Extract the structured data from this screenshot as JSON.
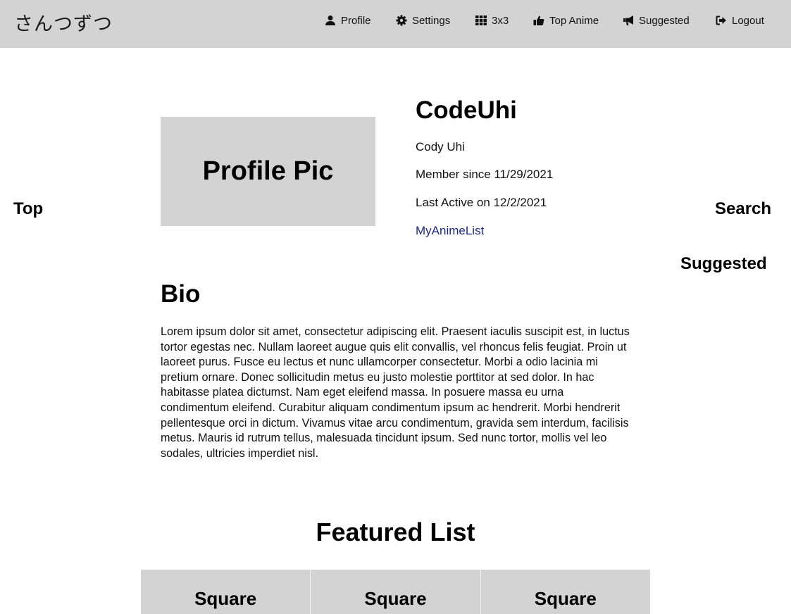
{
  "navbar": {
    "brand": "さんつずつ",
    "links": [
      {
        "label": "Profile",
        "icon": "user-icon"
      },
      {
        "label": "Settings",
        "icon": "gear-icon"
      },
      {
        "label": "3x3",
        "icon": "grid-icon"
      },
      {
        "label": "Top Anime",
        "icon": "thumbs-up-icon"
      },
      {
        "label": "Suggested",
        "icon": "megaphone-icon"
      },
      {
        "label": "Logout",
        "icon": "sign-out-icon"
      }
    ]
  },
  "sidebar": {
    "left": "Top",
    "right_search": "Search",
    "right_suggested": "Suggested"
  },
  "profile": {
    "pic_label": "Profile Pic",
    "username": "CodeUhi",
    "real_name": "Cody Uhi",
    "member_since": "Member since 11/29/2021",
    "last_active": "Last Active on 12/2/2021",
    "mal_link": "MyAnimeList"
  },
  "bio": {
    "heading": "Bio",
    "text": "Lorem ipsum dolor sit amet, consectetur adipiscing elit. Praesent iaculis suscipit est, in luctus tortor egestas nec. Nullam laoreet augue quis elit convallis, vel rhoncus felis feugiat. Proin ut laoreet purus. Fusce eu lectus et nunc ullamcorper consectetur. Morbi a odio lacinia mi pretium ornare. Donec sollicitudin metus eu justo molestie porttitor at sed dolor. In hac habitasse platea dictumst. Nam eget eleifend massa. In posuere massa eu urna condimentum eleifend. Curabitur aliquam condimentum ipsum ac hendrerit. Morbi hendrerit pellentesque orci in dictum. Vivamus vitae arcu condimentum, gravida sem interdum, facilisis metus. Mauris id rutrum tellus, malesuada tincidunt ipsum. Sed nunc tortor, mollis vel leo sodales, ultricies imperdiet nisl."
  },
  "featured": {
    "heading": "Featured List",
    "squares": [
      "Square",
      "Square",
      "Square"
    ]
  }
}
